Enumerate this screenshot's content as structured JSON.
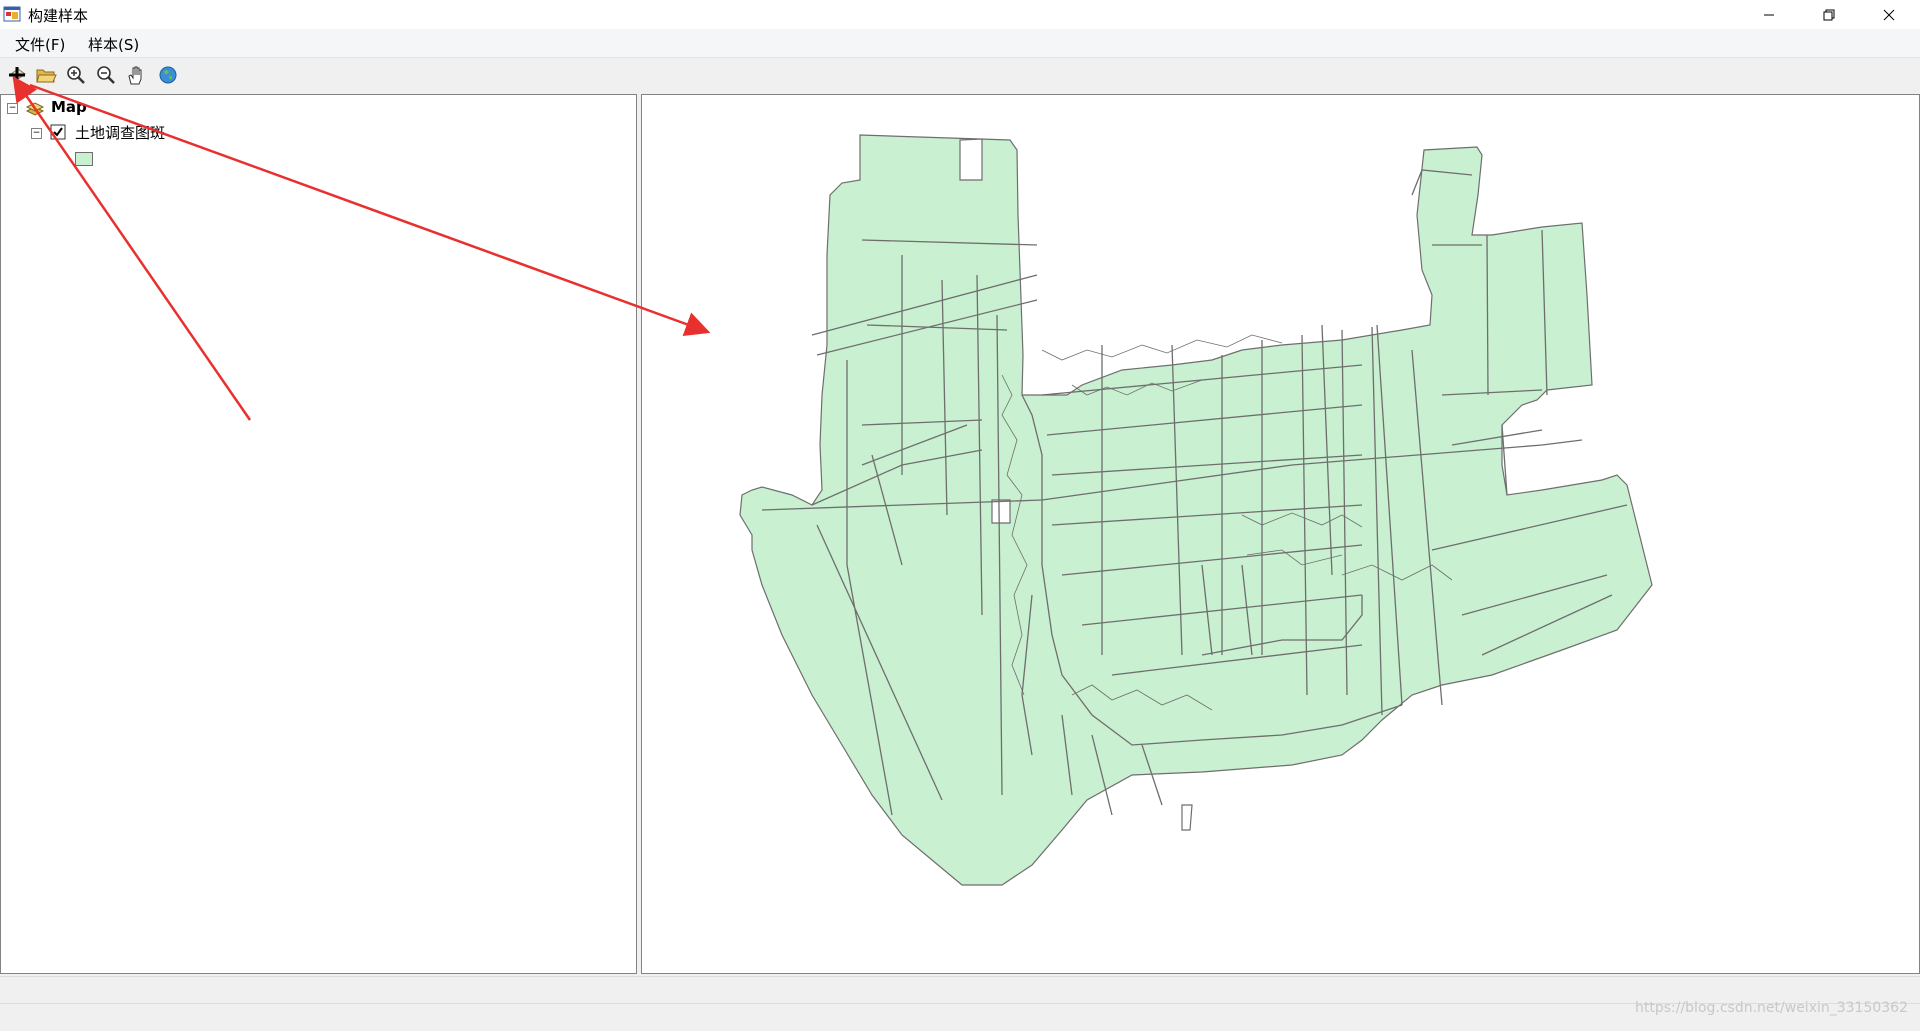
{
  "window": {
    "title": "构建样本"
  },
  "menu": {
    "items": [
      {
        "label": "文件(F)"
      },
      {
        "label": "样本(S)"
      }
    ]
  },
  "toolbar": {
    "tools": [
      "add-data-icon",
      "open-icon",
      "zoom-in-icon",
      "zoom-out-icon",
      "pan-icon",
      "full-extent-icon"
    ]
  },
  "toc": {
    "root_label": "Map",
    "layer_label": "土地调查图斑",
    "layer_checked": true,
    "symbol_color": "#c9f0d0"
  },
  "map": {
    "fill_color": "#c9f0d0",
    "stroke_color": "#6e6e6e"
  },
  "annotation": {
    "arrow_color": "#e8312f"
  },
  "watermark": "https://blog.csdn.net/weixin_33150362"
}
